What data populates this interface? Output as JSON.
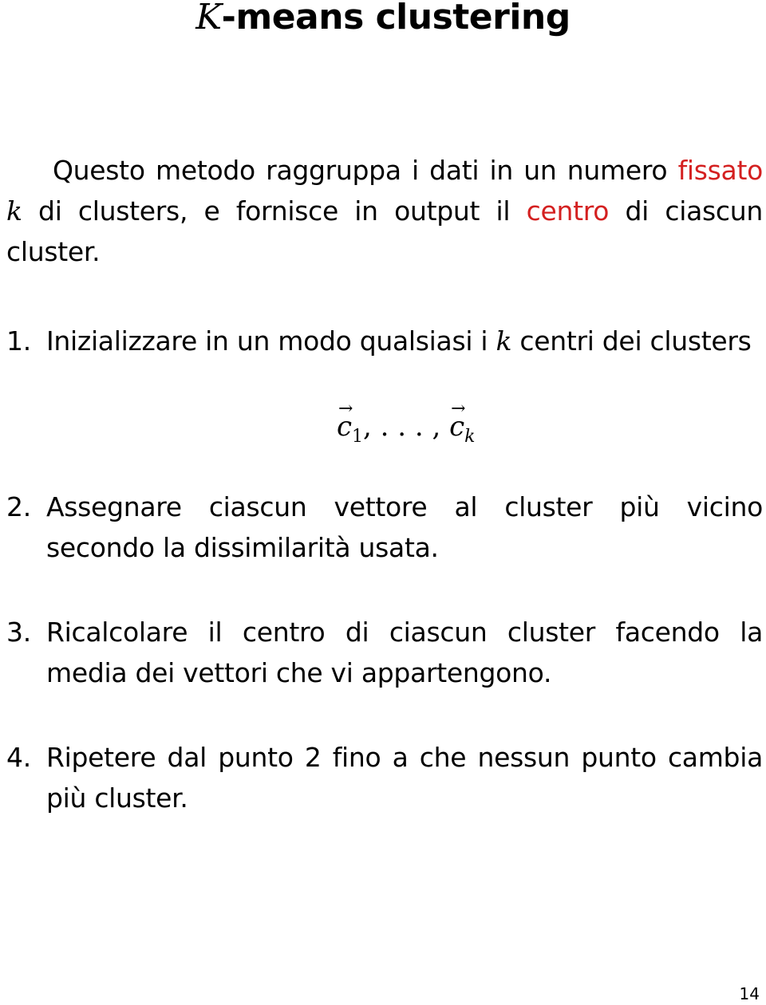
{
  "title": {
    "math_symbol": "K",
    "text": "-means clustering"
  },
  "intro": {
    "part1": "Questo metodo raggruppa i dati in un numero ",
    "highlight1": "fissato",
    "math_k": "k",
    "part2": " di clusters, e fornisce in output il ",
    "highlight2": "centro",
    "part3": " di ciascun cluster.",
    "highlight_color": "#d42020"
  },
  "steps": [
    {
      "number": "1.",
      "text_before": "Inizializzare in un modo qualsiasi i ",
      "math": "k",
      "text_after": " centri dei clusters"
    },
    {
      "number": "2.",
      "text": "Assegnare ciascun vettore al cluster più vicino secondo la dissimilarità usata."
    },
    {
      "number": "3.",
      "text": "Ricalcolare il centro di ciascun cluster facendo la media dei vettori che vi appartengono."
    },
    {
      "number": "4.",
      "text": "Ripetere dal punto 2 fino a che nessun punto cambia più cluster."
    }
  ],
  "formula": {
    "first": "c",
    "first_sub": "1",
    "ellipsis": ", . . . , ",
    "last": "c",
    "last_sub": "k"
  },
  "page_number": "14"
}
